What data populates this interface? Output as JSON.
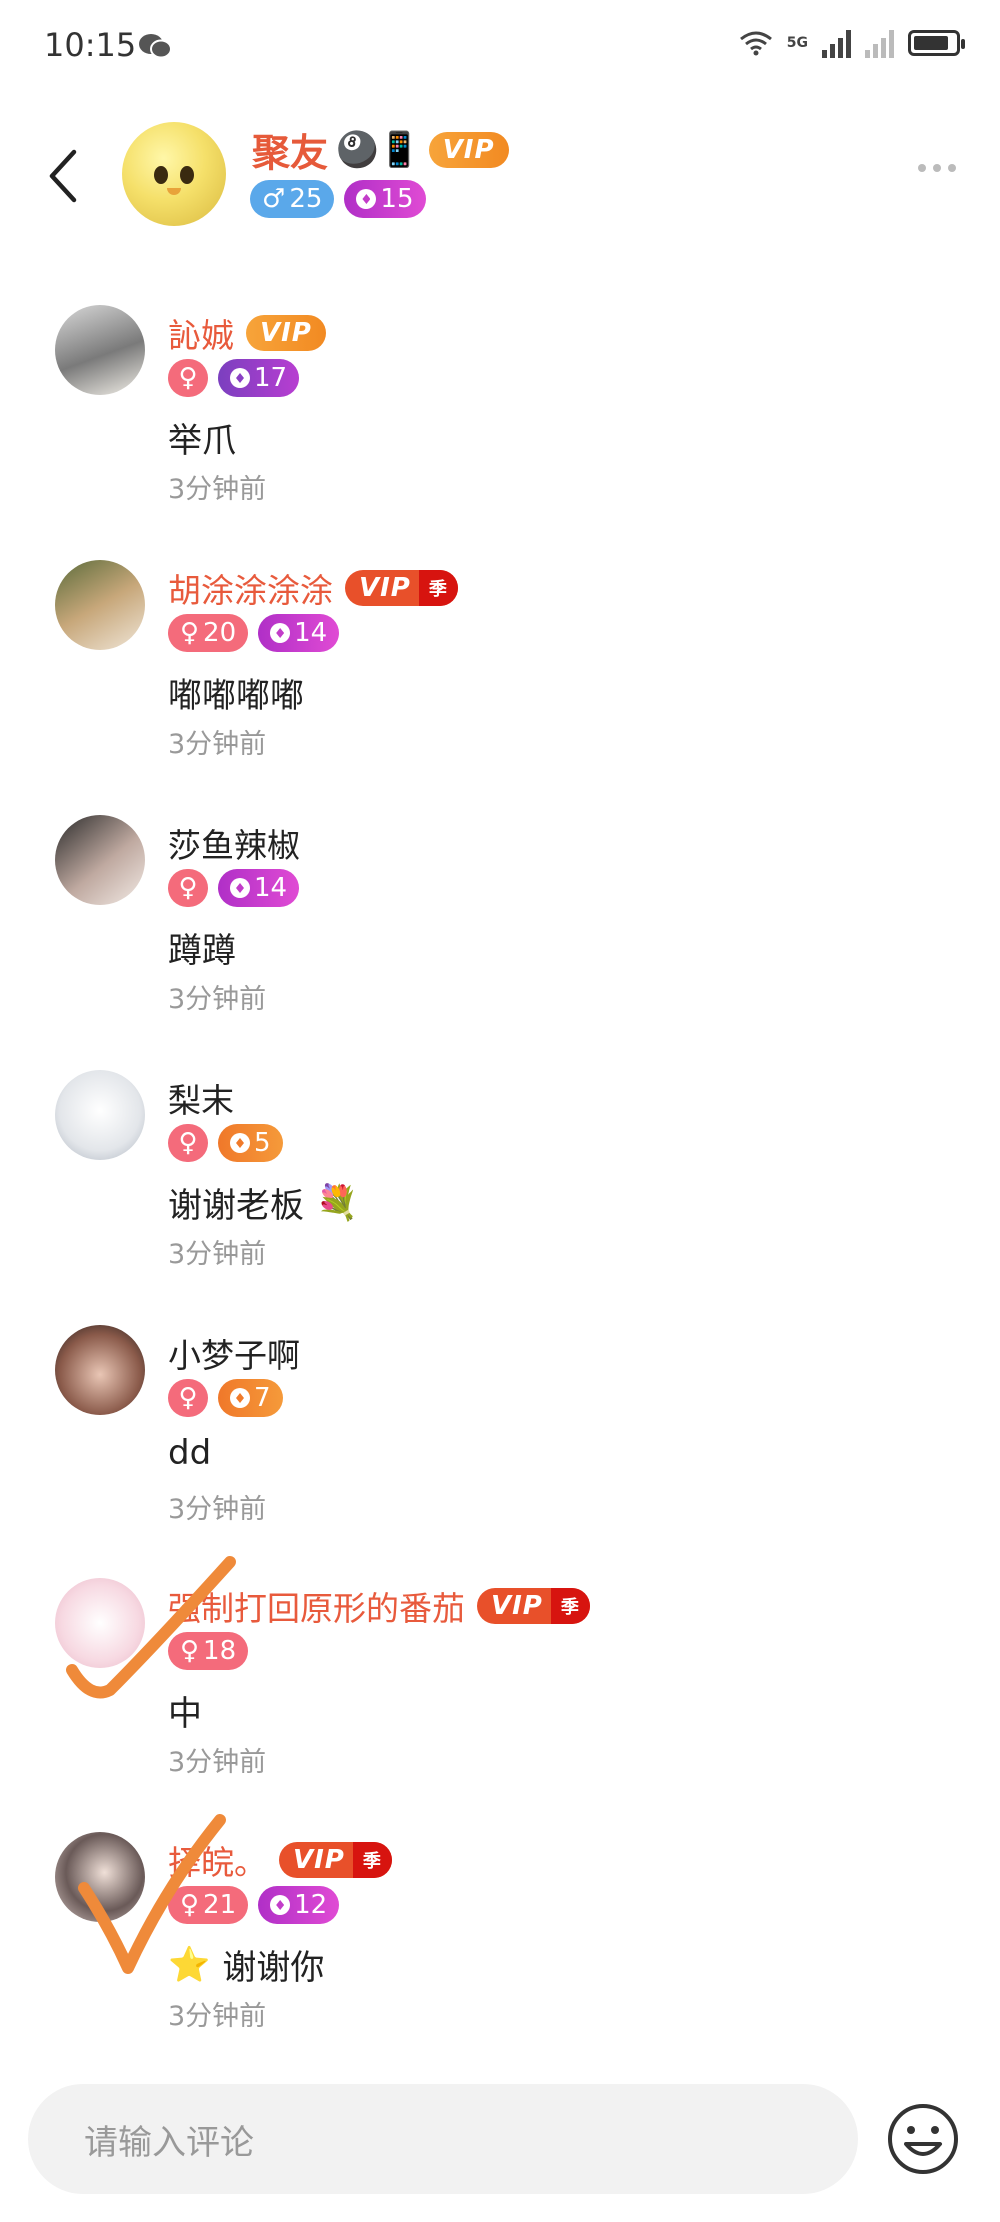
{
  "status_bar": {
    "time": "10:15",
    "network": "5G"
  },
  "header": {
    "group_name": "聚友",
    "name_emojis": "🎱📱",
    "vip_label": "VIP",
    "male_count": "25",
    "level": "15"
  },
  "comments": [
    {
      "name": "訫娍",
      "name_color": "#e85a3c",
      "vip": "VIP",
      "season": "",
      "gender_count": "",
      "level": "17",
      "level_style": "purple",
      "text": "举爪",
      "emoji": "",
      "time": "3分钟前"
    },
    {
      "name": "胡涂涂涂涂",
      "name_color": "#e85a3c",
      "vip": "VIP",
      "season": "季",
      "gender_count": "20",
      "level": "14",
      "level_style": "magenta",
      "text": "嘟嘟嘟嘟",
      "emoji": "",
      "time": "3分钟前"
    },
    {
      "name": "莎鱼辣椒",
      "name_color": "#222222",
      "vip": "",
      "season": "",
      "gender_count": "",
      "level": "14",
      "level_style": "magenta",
      "text": "蹲蹲",
      "emoji": "",
      "time": "3分钟前"
    },
    {
      "name": "梨末",
      "name_color": "#222222",
      "vip": "",
      "season": "",
      "gender_count": "",
      "level": "5",
      "level_style": "orange",
      "text": "谢谢老板",
      "emoji": "💐",
      "time": "3分钟前"
    },
    {
      "name": "小梦子啊",
      "name_color": "#222222",
      "vip": "",
      "season": "",
      "gender_count": "",
      "level": "7",
      "level_style": "orange",
      "text": "dd",
      "emoji": "",
      "time": "3分钟前"
    },
    {
      "name": "强制打回原形的番茄",
      "name_color": "#e85a3c",
      "vip": "VIP",
      "season": "季",
      "gender_count": "18",
      "level": "",
      "level_style": "",
      "text": "中",
      "emoji": "",
      "time": "3分钟前"
    },
    {
      "name": "择皖。",
      "name_color": "#e85a3c",
      "vip": "VIP",
      "season": "季",
      "gender_count": "21",
      "level": "12",
      "level_style": "magenta",
      "text": "谢谢你",
      "emoji": "⭐",
      "time": "3分钟前"
    }
  ],
  "input": {
    "placeholder": "请输入评论"
  },
  "icons": {
    "back": "chevron-left-icon",
    "more": "more-dots-icon",
    "emoji": "emoji-smile-icon",
    "wifi": "wifi-icon",
    "battery": "battery-icon",
    "wechat": "wechat-icon"
  },
  "colors": {
    "accent_red": "#e85a3c",
    "vip_orange": "#f28a22",
    "male_blue": "#5aa8ea",
    "female_pink": "#f46b7b",
    "check_orange": "#ef8a3a"
  }
}
